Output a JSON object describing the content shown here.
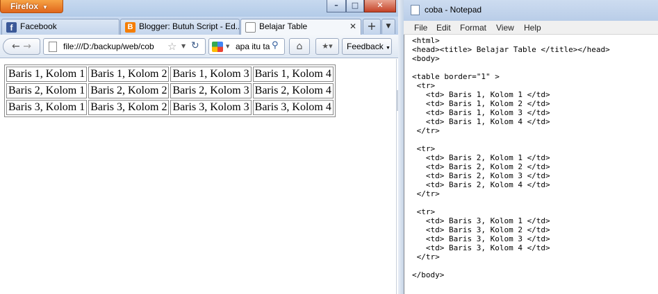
{
  "firefox": {
    "menu_label": "Firefox",
    "tabs": [
      {
        "title": "Facebook",
        "icon": "facebook-icon"
      },
      {
        "title": "Blogger: Butuh Script - Ed...",
        "icon": "blogger-icon"
      },
      {
        "title": "Belajar Table",
        "icon": "page-icon"
      }
    ],
    "url": "file:///D:/backup/web/cob",
    "search_text": "apa itu tal",
    "feedback_label": "Feedback",
    "table": [
      [
        "Baris 1, Kolom 1",
        "Baris 1, Kolom 2",
        "Baris 1, Kolom 3",
        "Baris 1, Kolom 4"
      ],
      [
        "Baris 2, Kolom 1",
        "Baris 2, Kolom 2",
        "Baris 2, Kolom 3",
        "Baris 2, Kolom 4"
      ],
      [
        "Baris 3, Kolom 1",
        "Baris 3, Kolom 2",
        "Baris 3, Kolom 3",
        "Baris 3, Kolom 4"
      ]
    ]
  },
  "notepad": {
    "title": "coba - Notepad",
    "menu": [
      "File",
      "Edit",
      "Format",
      "View",
      "Help"
    ],
    "content": "<html>\n<head><title> Belajar Table </title></head>\n<body>\n\n<table border=\"1\" >\n <tr>\n   <td> Baris 1, Kolom 1 </td>\n   <td> Baris 1, Kolom 2 </td>\n   <td> Baris 1, Kolom 3 </td>\n   <td> Baris 1, Kolom 4 </td>\n </tr>\n\n <tr>\n   <td> Baris 2, Kolom 1 </td>\n   <td> Baris 2, Kolom 2 </td>\n   <td> Baris 2, Kolom 3 </td>\n   <td> Baris 2, Kolom 4 </td>\n </tr>\n\n <tr>\n   <td> Baris 3, Kolom 1 </td>\n   <td> Baris 3, Kolom 2 </td>\n   <td> Baris 3, Kolom 3 </td>\n   <td> Baris 3, Kolom 4 </td>\n </tr>\n\n</body>"
  }
}
